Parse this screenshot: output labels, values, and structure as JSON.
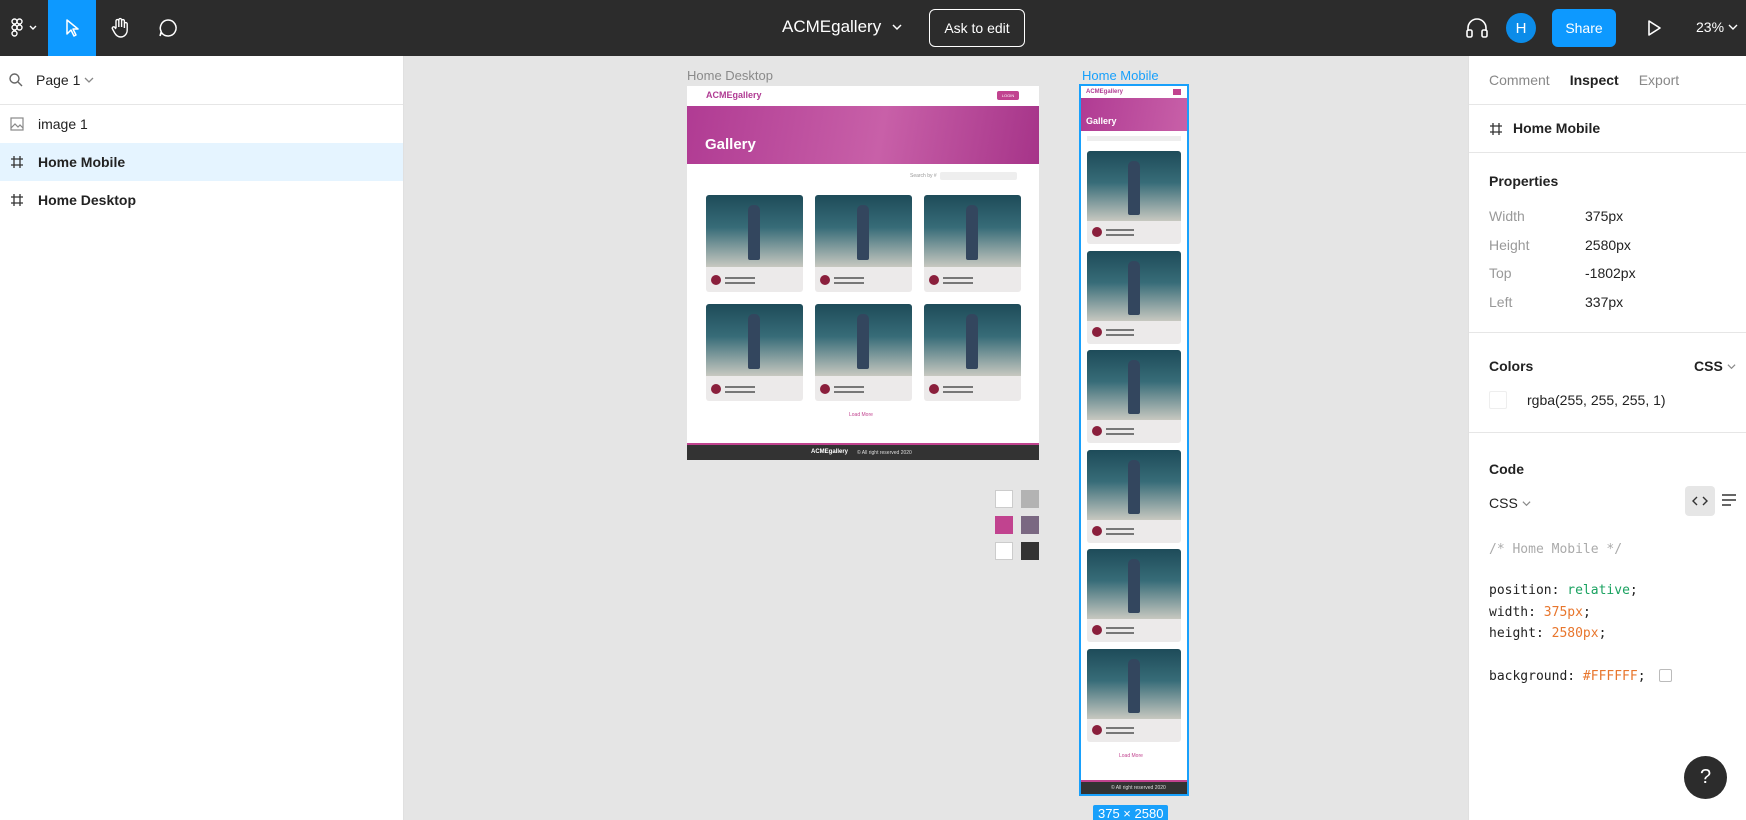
{
  "topbar": {
    "file_name": "ACMEgallery",
    "ask_to_edit": "Ask to edit",
    "avatar_initial": "H",
    "share": "Share",
    "zoom": "23%"
  },
  "left_panel": {
    "page": "Page 1",
    "layers": [
      "image 1",
      "Home Mobile",
      "Home Desktop"
    ]
  },
  "canvas": {
    "desktop_frame_label": "Home Desktop",
    "mobile_frame_label": "Home Mobile",
    "hero_title": "Gallery",
    "search_label": "Search by #",
    "load_more": "Load More",
    "desktop_footer": "© All right reserved 2020",
    "mobile_footer": "© All right reserved 2020",
    "login": "LOGIN",
    "logo": "ACMEgallery",
    "card_name": "Sam Jenneny",
    "card_tag": "#dayAtTheBeach",
    "size_badge": "375 × 2580",
    "swatch_colors": [
      "#FFFFFF",
      "#B3B3B3",
      "#C1438F",
      "#7A6882",
      "#FFFFFF",
      "#333333"
    ]
  },
  "right_panel": {
    "tabs": [
      "Comment",
      "Inspect",
      "Export"
    ],
    "active_tab": "Inspect",
    "selection": "Home Mobile",
    "properties_title": "Properties",
    "properties": [
      {
        "label": "Width",
        "value": "375px"
      },
      {
        "label": "Height",
        "value": "2580px"
      },
      {
        "label": "Top",
        "value": "-1802px"
      },
      {
        "label": "Left",
        "value": "337px"
      }
    ],
    "colors_title": "Colors",
    "colors_format": "CSS",
    "color_value": "rgba(255, 255, 255, 1)",
    "code_title": "Code",
    "code_lang": "CSS",
    "code_comment": "/* Home Mobile */",
    "code_lines": [
      {
        "prop": "position:",
        "val": "relative",
        "kind": "keyword"
      },
      {
        "prop": "width:",
        "val": "375px",
        "kind": "number"
      },
      {
        "prop": "height:",
        "val": "2580px",
        "kind": "number"
      }
    ],
    "code_background_prop": "background:",
    "code_background_val": "#FFFFFF"
  }
}
